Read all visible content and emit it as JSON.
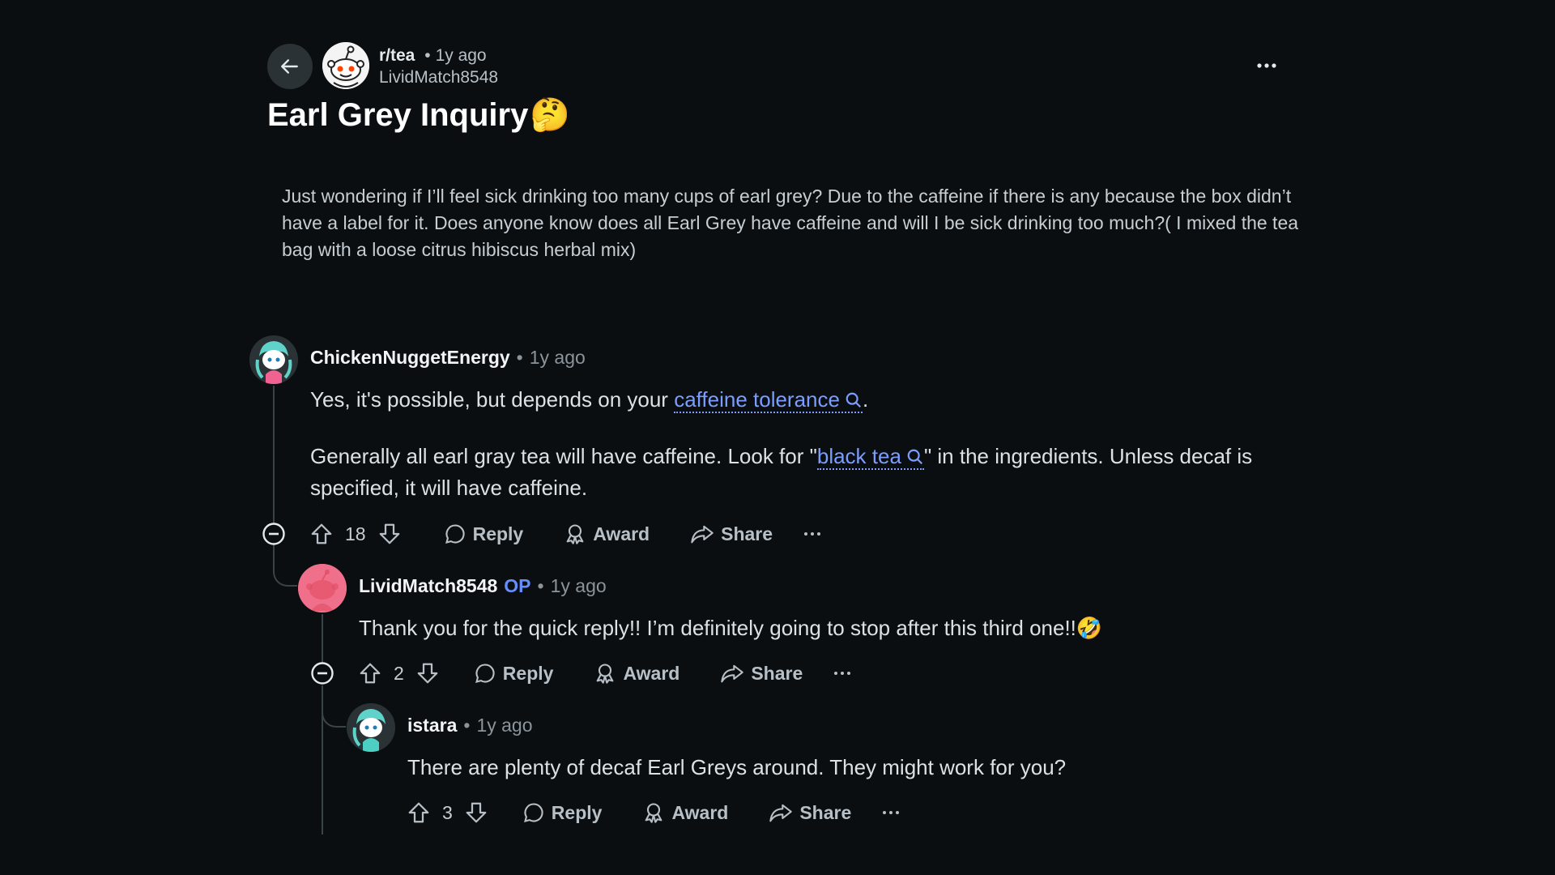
{
  "header": {
    "subreddit": "r/tea",
    "separator": "•",
    "post_age": "1y ago",
    "author": "LividMatch8548",
    "title": "Earl Grey Inquiry",
    "title_emoji": "🤔"
  },
  "post": {
    "body": "Just wondering if I’ll feel sick drinking too many cups of earl grey? Due to the caffeine if there is any because the box didn’t have a label for it. Does anyone know does all Earl Grey have caffeine and will I be sick drinking too much?( I mixed the tea bag with a loose citrus hibiscus herbal mix)"
  },
  "labels": {
    "reply": "Reply",
    "award": "Award",
    "share": "Share",
    "separator": "•"
  },
  "comments": [
    {
      "author": "ChickenNuggetEnergy",
      "time": "1y ago",
      "p1_before": "Yes, it's possible, but depends on your ",
      "p1_link": "caffeine tolerance",
      "p1_after": ".",
      "p2_before": "Generally all earl gray tea will have caffeine. Look for \"",
      "p2_link": "black tea",
      "p2_after": "\" in the ingredients. Unless decaf is specified, it will have caffeine.",
      "votes": "18"
    },
    {
      "author": "LividMatch8548",
      "op_badge": "OP",
      "time": "1y ago",
      "text": "Thank you for the quick reply!! I’m definitely going to stop after this third one!!",
      "emoji": "🤣",
      "votes": "2"
    },
    {
      "author": "istara",
      "time": "1y ago",
      "text": "There are plenty of decaf Earl Greys around. They might work for you?",
      "votes": "3"
    }
  ],
  "colors": {
    "background": "#0b0e11",
    "link": "#7b9dff",
    "op_badge": "#648efc"
  }
}
